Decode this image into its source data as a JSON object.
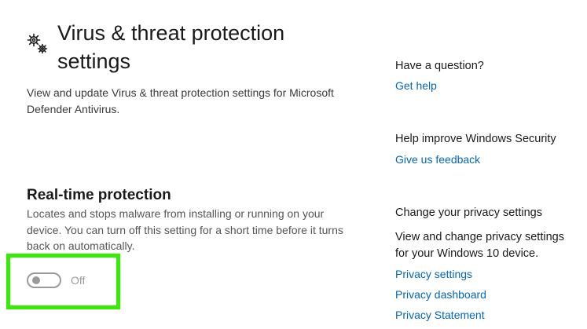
{
  "header": {
    "icon": "gears-icon",
    "title": "Virus & threat protection settings",
    "description": "View and update Virus & threat protection settings for Microsoft Defender Antivirus."
  },
  "realtime": {
    "title": "Real-time protection",
    "description": "Locates and stops malware from installing or running on your device. You can turn off this setting for a short time before it turns back on automatically.",
    "toggle_state": "Off",
    "enabled": false
  },
  "sidebar": {
    "question": {
      "heading": "Have a question?",
      "link": "Get help"
    },
    "improve": {
      "heading": "Help improve Windows Security",
      "link": "Give us feedback"
    },
    "privacy": {
      "heading": "Change your privacy settings",
      "text": "View and change privacy settings for your Windows 10 device.",
      "links": [
        "Privacy settings",
        "Privacy dashboard",
        "Privacy Statement"
      ]
    }
  },
  "colors": {
    "link": "#0067b8",
    "highlight": "#33ee00",
    "toggle_off": "#9a9a9a"
  }
}
